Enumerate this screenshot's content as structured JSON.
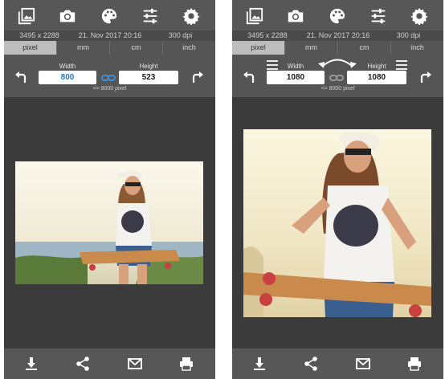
{
  "left": {
    "info": {
      "dimensions": "3495 x 2288",
      "date": "21. Nov 2017 20:16",
      "dpi": "300 dpi"
    },
    "units": [
      "pixel",
      "mm",
      "cm",
      "inch"
    ],
    "active_unit": "pixel",
    "width_label": "Width",
    "height_label": "Height",
    "width_value": "800",
    "height_value": "523",
    "hint": "<= 8000 pixel"
  },
  "right": {
    "info": {
      "dimensions": "3495 x 2288",
      "date": "21. Nov 2017 20:16",
      "dpi": "300 dpi"
    },
    "units": [
      "pixel",
      "mm",
      "cm",
      "inch"
    ],
    "active_unit": "pixel",
    "width_label": "Width",
    "height_label": "Height",
    "width_value": "1080",
    "height_value": "1080",
    "hint": "<= 8000 pixel"
  },
  "toolbar_icons": [
    "gallery-icon",
    "camera-icon",
    "palette-icon",
    "sliders-icon",
    "gear-icon"
  ],
  "bottom_icons": [
    "download-icon",
    "share-icon",
    "mail-icon",
    "print-icon"
  ],
  "colors": {
    "accent": "#2a7ac4",
    "panel": "#575757",
    "background": "#3b3b3b"
  }
}
